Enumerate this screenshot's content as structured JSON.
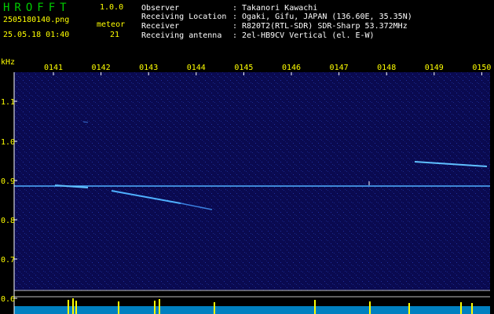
{
  "header": {
    "app_title": "HROFFT",
    "version": "1.0.0",
    "filename": "2505180140.png",
    "date_time": "25.05.18 01:40",
    "meteor_label": "meteor",
    "meteor_count": "21",
    "info": [
      {
        "key": "Observer",
        "value": "Takanori Kawachi"
      },
      {
        "key": "Receiving Location",
        "value": "Ogaki, Gifu, JAPAN (136.60E, 35.35N)"
      },
      {
        "key": "Receiver",
        "value": "R820T2(RTL-SDR) SDR-Sharp 53.372MHz"
      },
      {
        "key": "Receiving antenna",
        "value": "2el-HB9CV Vertical (el. E-W)"
      }
    ]
  },
  "spectrogram": {
    "y_unit": "kHz",
    "y_ticks": [
      "1.1",
      "1.0",
      "0.9",
      "0.8",
      "0.7",
      "0.6"
    ],
    "time_labels": [
      "0141",
      "0142",
      "0143",
      "0144",
      "0145",
      "0146",
      "0147",
      "0148",
      "0149",
      "0150"
    ],
    "colors": {
      "background": "#0a0a50",
      "signal": "#4fb0ff",
      "label": "#ffff00",
      "axis": "#ffffff"
    }
  }
}
